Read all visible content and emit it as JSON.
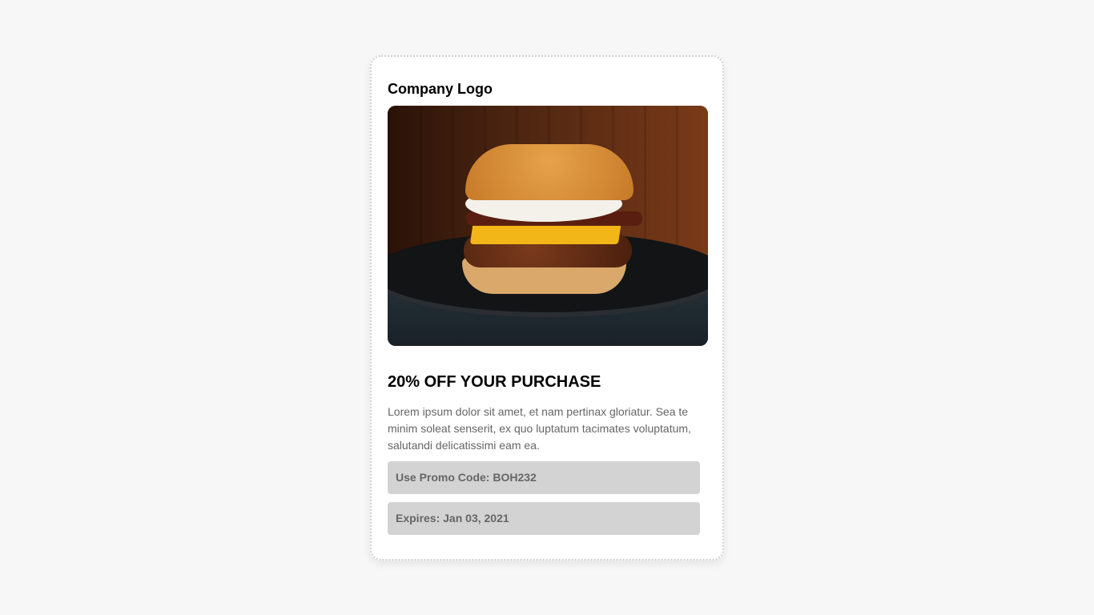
{
  "card": {
    "logo": "Company Logo",
    "image": "burger-photo",
    "title": "20% OFF YOUR PURCHASE",
    "body": "Lorem ipsum dolor sit amet, et nam pertinax gloriatur. Sea te minim soleat senserit, ex quo luptatum tacimates voluptatum, salutandi delicatissimi eam ea.",
    "promo": "Use Promo Code: BOH232",
    "expires": "Expires: Jan 03, 2021"
  },
  "colors": {
    "page_bg": "#f7f7f7",
    "box_bg": "#d3d3d3",
    "text_muted": "#666666"
  }
}
